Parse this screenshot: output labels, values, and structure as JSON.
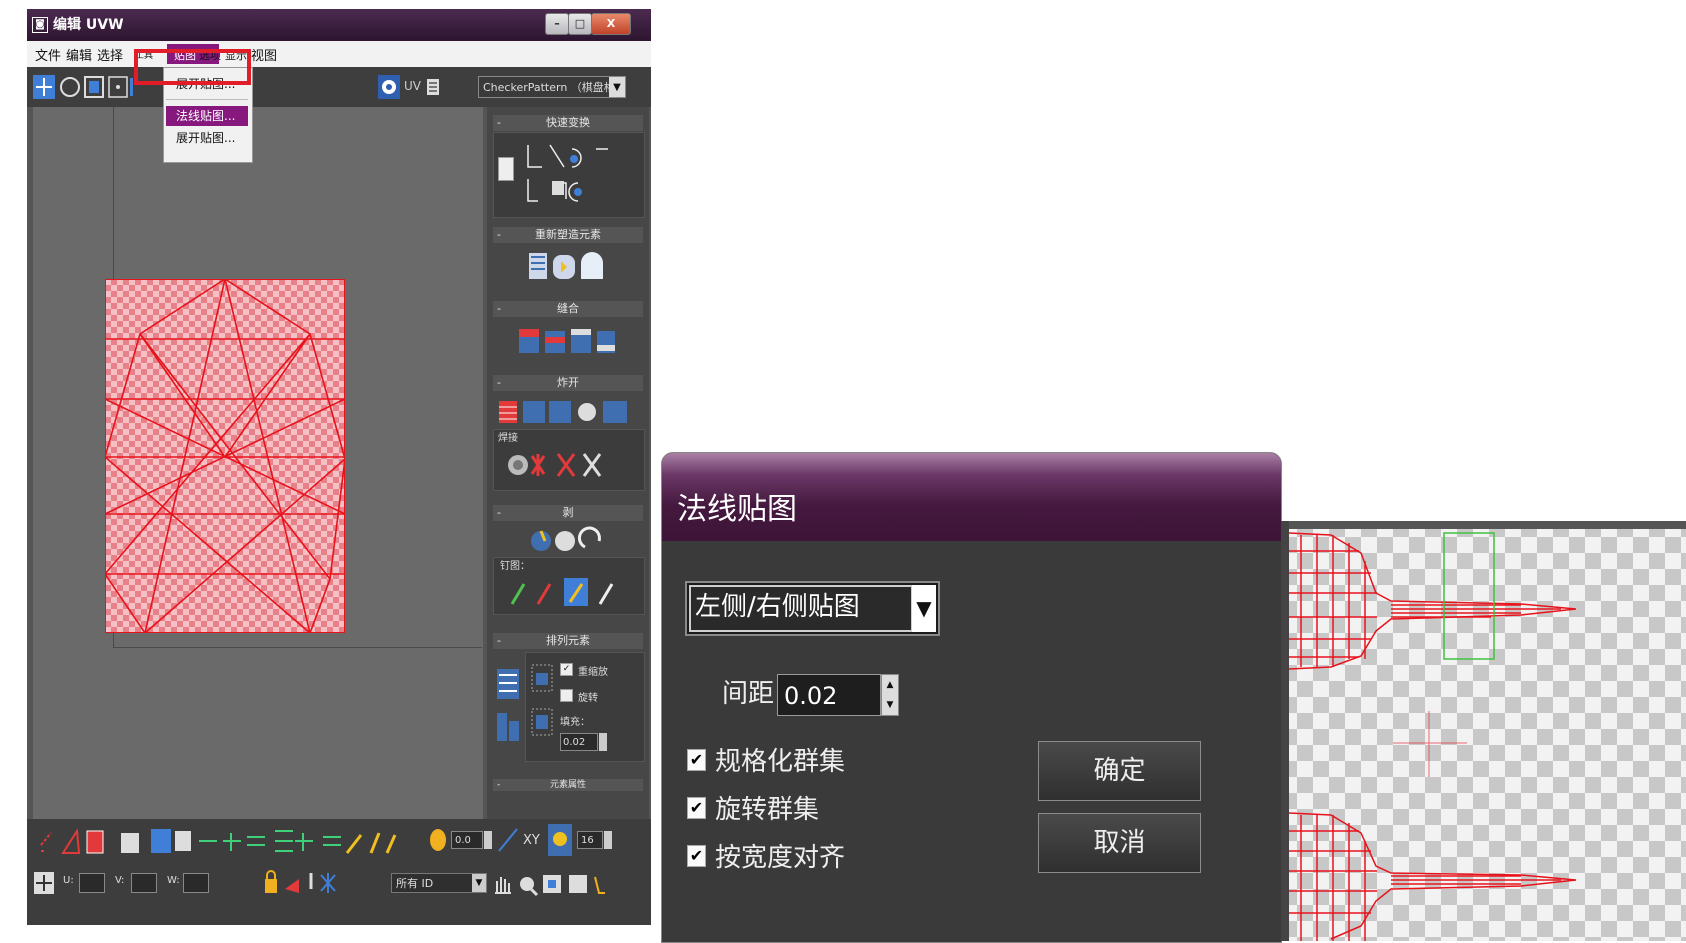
{
  "uvw_window": {
    "title": "编辑 UVW",
    "icon_glyph": "◙",
    "win_buttons": {
      "minimize": "–",
      "maximize": "□",
      "close": "X"
    },
    "menu": [
      {
        "label": "文件"
      },
      {
        "label": "编辑"
      },
      {
        "label": "选择"
      },
      {
        "label": "工具"
      },
      {
        "label": "贴图"
      },
      {
        "label": "选项"
      },
      {
        "label": "显示"
      },
      {
        "label": "视图"
      }
    ],
    "dropdown_items": [
      "展开贴图...",
      "法线贴图...",
      "展开贴图..."
    ],
    "toolbar": {
      "uv_label": "UV",
      "texture_select": "CheckerPattern （棋盘格"
    },
    "right_panel": {
      "sections": [
        "快速变换",
        "重新塑造元素",
        "缝合",
        "炸开",
        "剥",
        "排列元素",
        "元素属性"
      ],
      "weld_label": "焊接",
      "pin_label": "钉图：",
      "arrange": {
        "rescale_label": "重缩放",
        "rotate_label": "旋转",
        "fill_label": "填充：",
        "fill_value": "0.02"
      }
    },
    "bottom": {
      "u_label": "U:",
      "v_label": "V:",
      "w_label": "W:",
      "value_a": "0.0",
      "value_b": "16",
      "xy_label": "XY",
      "mat_id": "所有 ID"
    }
  },
  "dialog": {
    "title": "法线贴图",
    "map_select": "左侧/右侧贴图",
    "spacing_label": "间距:",
    "spacing_value": "0.02",
    "checkboxes": [
      {
        "label": "规格化群集",
        "checked": true
      },
      {
        "label": "旋转群集",
        "checked": true
      },
      {
        "label": "按宽度对齐",
        "checked": true
      }
    ],
    "ok_label": "确定",
    "cancel_label": "取消"
  },
  "colors": {
    "wire": "#e8121b",
    "menu_highlight": "#86187e",
    "title_purple": "#4b2b4f",
    "select_green": "#3ec23e"
  }
}
